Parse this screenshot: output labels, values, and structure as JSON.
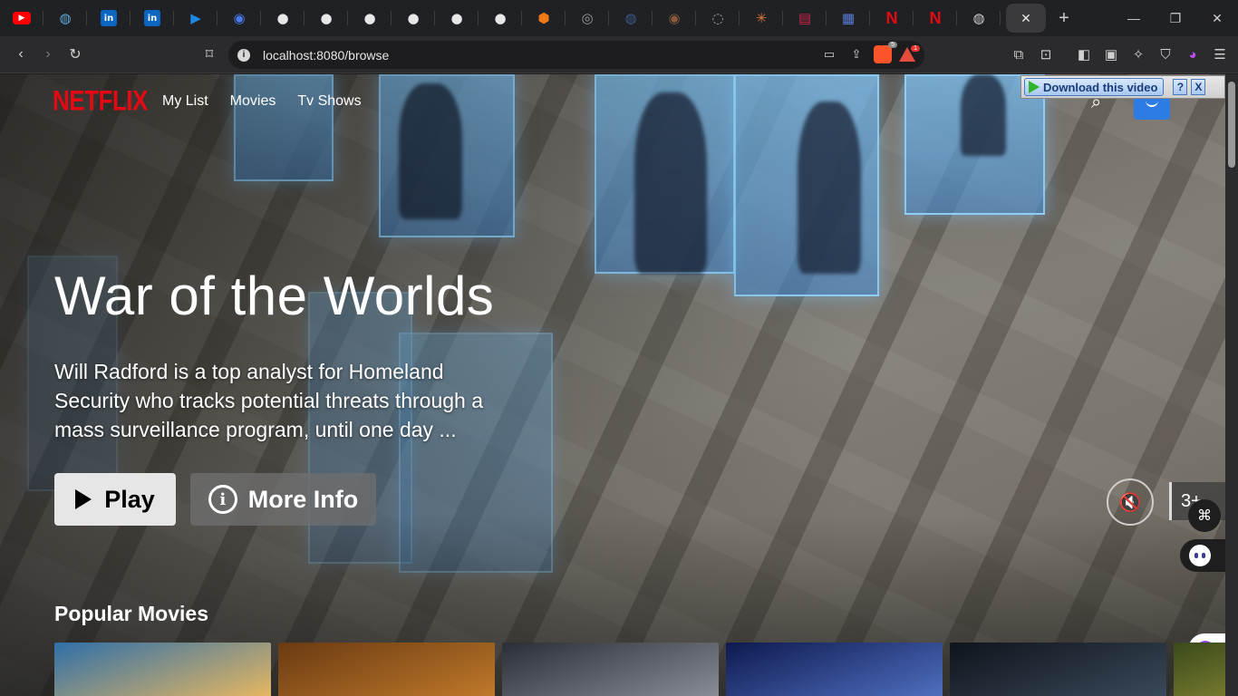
{
  "browser": {
    "tabs": [
      {
        "icon": "youtube-icon",
        "color": "#ff0000",
        "glyph": "▶"
      },
      {
        "icon": "globe-icon",
        "color": "#5fa8d3",
        "glyph": "◍"
      },
      {
        "icon": "linkedin-icon",
        "color": "#0a66c2",
        "glyph": "in"
      },
      {
        "icon": "linkedin-icon",
        "color": "#0a66c2",
        "glyph": "in"
      },
      {
        "icon": "video-icon",
        "color": "#1e88e5",
        "glyph": "▶"
      },
      {
        "icon": "target-icon",
        "color": "#4a7cf0",
        "glyph": "◉"
      },
      {
        "icon": "github-icon",
        "color": "#e8e8e8",
        "glyph": "●"
      },
      {
        "icon": "github-icon",
        "color": "#e8e8e8",
        "glyph": "●"
      },
      {
        "icon": "github-icon",
        "color": "#e8e8e8",
        "glyph": "●"
      },
      {
        "icon": "github-icon",
        "color": "#e8e8e8",
        "glyph": "●"
      },
      {
        "icon": "github-icon",
        "color": "#e8e8e8",
        "glyph": "●"
      },
      {
        "icon": "github-icon",
        "color": "#e8e8e8",
        "glyph": "●"
      },
      {
        "icon": "hexagon-icon",
        "color": "#f07a1a",
        "glyph": "⬢"
      },
      {
        "icon": "globe-icon",
        "color": "#9a9a9a",
        "glyph": "◎"
      },
      {
        "icon": "orb-icon",
        "color": "#3b5b8a",
        "glyph": "◍"
      },
      {
        "icon": "badge-icon",
        "color": "#8a5a3a",
        "glyph": "◉"
      },
      {
        "icon": "ring-icon",
        "color": "#aaaaaa",
        "glyph": "◌"
      },
      {
        "icon": "sunburst-icon",
        "color": "#e0763a",
        "glyph": "✳"
      },
      {
        "icon": "film-icon",
        "color": "#cc2244",
        "glyph": "▤"
      },
      {
        "icon": "document-icon",
        "color": "#5a7cd6",
        "glyph": "▦"
      },
      {
        "icon": "netflix-icon",
        "color": "#e50914",
        "glyph": "N"
      },
      {
        "icon": "netflix-icon",
        "color": "#e50914",
        "glyph": "N"
      },
      {
        "icon": "globe-icon",
        "color": "#cfcfcf",
        "glyph": "◍"
      }
    ],
    "url": "localhost:8080/browse",
    "shield_badge": "5",
    "alert_badge": "1"
  },
  "download_bar": {
    "label": "Download this video",
    "help": "?",
    "close": "X"
  },
  "nav": {
    "logo": "NETFLIX",
    "links": [
      "My List",
      "Movies",
      "Tv Shows"
    ],
    "accent": "#e50914"
  },
  "hero": {
    "title": "War of the Worlds",
    "description": "Will Radford is a top analyst for Homeland Security who tracks potential threats through a mass surveillance program, until one day ...",
    "play_label": "Play",
    "info_label": "More Info",
    "rating": "3+"
  },
  "popular": {
    "title": "Popular Movies",
    "cards": [
      {
        "name": "card-1",
        "c1": "#2f6fa8",
        "c2": "#e8b860"
      },
      {
        "name": "card-2",
        "c1": "#6a3a12",
        "c2": "#c07a2a"
      },
      {
        "name": "card-3",
        "c1": "#2a2e36",
        "c2": "#8a8e96"
      },
      {
        "name": "card-4",
        "c1": "#0e1a50",
        "c2": "#5070c0"
      },
      {
        "name": "card-5",
        "c1": "#0f141c",
        "c2": "#3a4a5a"
      },
      {
        "name": "card-6",
        "c1": "#3a4a1a",
        "c2": "#a8a040"
      }
    ]
  }
}
